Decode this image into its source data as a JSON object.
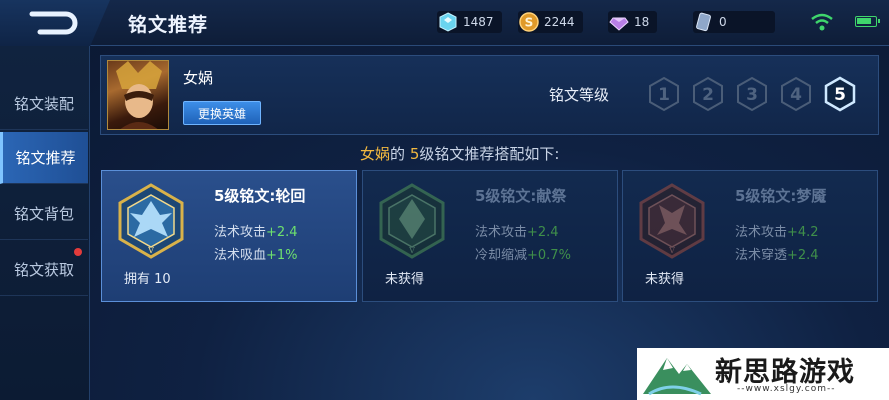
{
  "header": {
    "title": "铭文推荐",
    "currencies": [
      {
        "icon": "diamond-cube-icon",
        "value": "1487"
      },
      {
        "icon": "gold-coin-icon",
        "value": "2244"
      },
      {
        "icon": "purple-gem-icon",
        "value": "18"
      },
      {
        "icon": "voucher-icon",
        "value": "0"
      }
    ]
  },
  "sidebar": {
    "items": [
      {
        "label": "铭文装配",
        "active": false
      },
      {
        "label": "铭文推荐",
        "active": true
      },
      {
        "label": "铭文背包",
        "active": false
      },
      {
        "label": "铭文获取",
        "active": false,
        "badge": true
      }
    ]
  },
  "hero": {
    "name": "女娲",
    "change_button": "更换英雄",
    "level_label": "铭文等级",
    "levels": [
      "1",
      "2",
      "3",
      "4",
      "5"
    ],
    "selected_level": "5"
  },
  "subtitle": {
    "hero": "女娲",
    "middle": "的",
    "level": "5",
    "rest": "级铭文推荐搭配如下:"
  },
  "cards": [
    {
      "title": "5级铭文:轮回",
      "stats": [
        {
          "name": "法术攻击",
          "value": "+2.4"
        },
        {
          "name": "法术吸血",
          "value": "+1%"
        }
      ],
      "footer": "拥有 10",
      "color": "#d9b24a"
    },
    {
      "title": "5级铭文:献祭",
      "stats": [
        {
          "name": "法术攻击",
          "value": "+2.4"
        },
        {
          "name": "冷却缩减",
          "value": "+0.7%"
        }
      ],
      "footer": "未获得",
      "color": "#5fae5a"
    },
    {
      "title": "5级铭文:梦魇",
      "stats": [
        {
          "name": "法术攻击",
          "value": "+4.2"
        },
        {
          "name": "法术穿透",
          "value": "+2.4"
        }
      ],
      "footer": "未获得",
      "color": "#c0563d"
    }
  ],
  "watermark": {
    "text": "新思路游戏",
    "url": "--www.xslgy.com--"
  }
}
